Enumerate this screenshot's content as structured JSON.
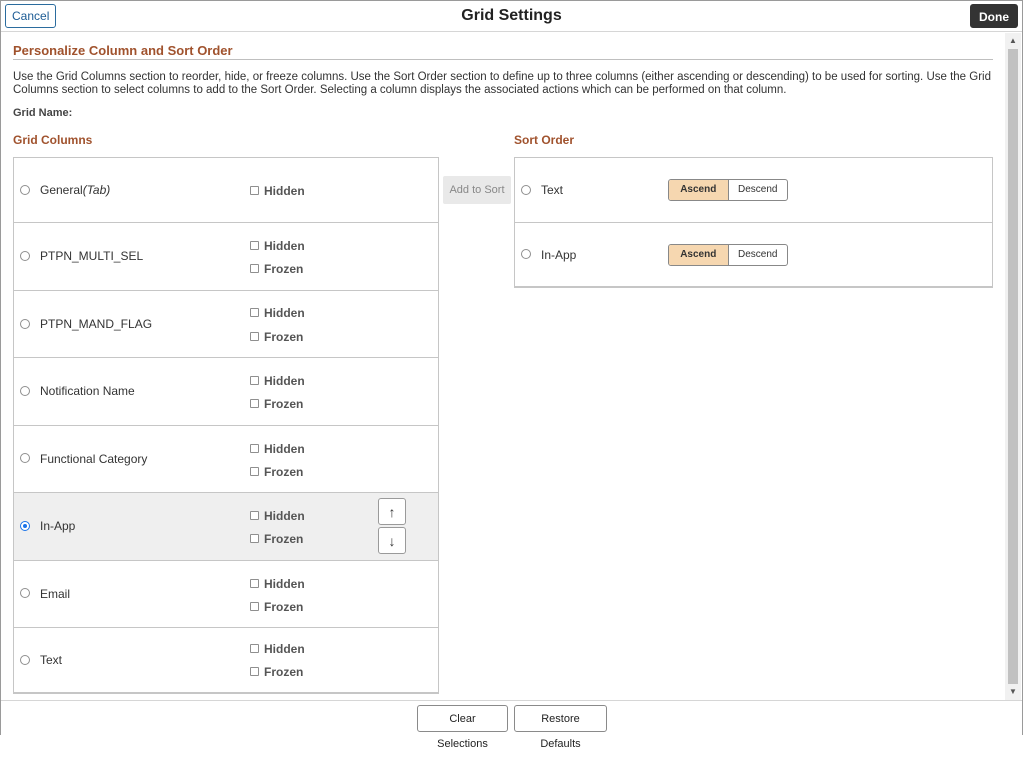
{
  "header": {
    "cancel_label": "Cancel",
    "title": "Grid Settings",
    "done_label": "Done"
  },
  "section": {
    "title": "Personalize Column and Sort Order",
    "instructions": "Use the Grid Columns section to reorder, hide, or freeze columns.  Use the Sort Order section to define up to three columns (either ascending or descending) to be used for sorting.  Use the Grid Columns section to select columns to add to the Sort Order. Selecting a column displays the associated actions which can be performed on that column.",
    "grid_name_label": "Grid Name:"
  },
  "grid_columns": {
    "title": "Grid Columns",
    "hidden_label": "Hidden",
    "frozen_label": "Frozen",
    "rows": [
      {
        "label": "General",
        "suffix": "(Tab)",
        "selected": false
      },
      {
        "label": "PTPN_MULTI_SEL",
        "suffix": "",
        "selected": false
      },
      {
        "label": "PTPN_MAND_FLAG",
        "suffix": "",
        "selected": false
      },
      {
        "label": "Notification Name",
        "suffix": "",
        "selected": false
      },
      {
        "label": "Functional Category",
        "suffix": "",
        "selected": false
      },
      {
        "label": "In-App",
        "suffix": "",
        "selected": true
      },
      {
        "label": "Email",
        "suffix": "",
        "selected": false
      },
      {
        "label": "Text",
        "suffix": "",
        "selected": false
      }
    ],
    "move_up_glyph": "↑",
    "move_down_glyph": "↓"
  },
  "add_to_sort_label": "Add to Sort",
  "sort_order": {
    "title": "Sort Order",
    "rows": [
      {
        "label": "Text",
        "ascend_label": "Ascend",
        "descend_label": "Descend",
        "direction": "ascend"
      },
      {
        "label": "In-App",
        "ascend_label": "Ascend",
        "descend_label": "Descend",
        "direction": "ascend"
      }
    ]
  },
  "footer": {
    "clear_label": "Clear Selections",
    "restore_label": "Restore Defaults"
  },
  "colors": {
    "section_title": "#a0522d",
    "ascend_active": "#f6d7b0",
    "done_bg": "#333333",
    "selected_row_bg": "#efefef"
  }
}
